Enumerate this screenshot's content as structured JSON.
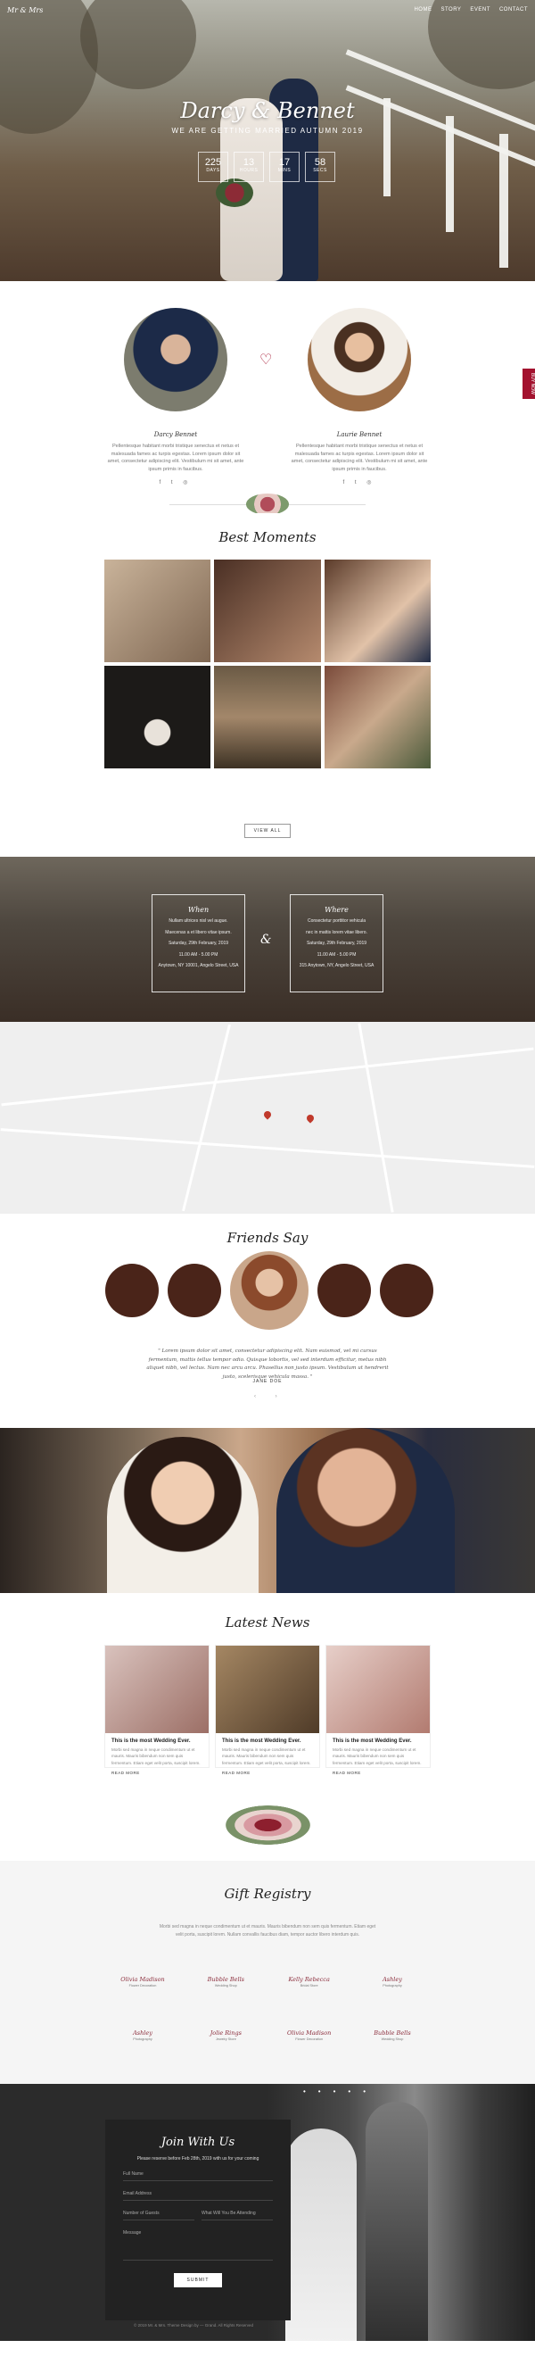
{
  "nav": {
    "logo": "Mr & Mrs",
    "menu": [
      "HOME",
      "STORY",
      "EVENT",
      "CONTACT"
    ]
  },
  "hero": {
    "title": "Darcy & Bennet",
    "subtitle": "WE ARE GETTING MARRIED AUTUMN 2019",
    "countdown": [
      {
        "value": "225",
        "label": "DAYS"
      },
      {
        "value": "13",
        "label": "HOURS"
      },
      {
        "value": "17",
        "label": "MINS"
      },
      {
        "value": "58",
        "label": "SECS"
      }
    ]
  },
  "couple": {
    "groom": {
      "name": "Darcy Bennet",
      "desc": "Pellentesque habitant morbi tristique senectus et netus et malesuada fames ac turpis egestas. Lorem ipsum dolor sit amet, consectetur adipiscing elit. Vestibulum mi sit amet, ante ipsum primis in faucibus.",
      "social": "f  t  ◎"
    },
    "bride": {
      "name": "Laurie Bennet",
      "desc": "Pellentesque habitant morbi tristique senectus et netus et malesuada fames ac turpis egestas. Lorem ipsum dolor sit amet, consectetur adipiscing elit. Vestibulum mi sit amet, ante ipsum primis in faucibus.",
      "social": "f  t  ◎"
    },
    "side_tab": "BUY NOW"
  },
  "moments": {
    "title": "Best Moments",
    "button": "VIEW ALL",
    "photos": [
      "#b79f86",
      "#5b3b2e",
      "#6f4a36",
      "#2a2623",
      "#8b6a4b",
      "#6e4a3a"
    ]
  },
  "event": {
    "cards": [
      {
        "title": "When",
        "lines": [
          "Nullam ultrices nisl vel augue.",
          "Maecenas a et libero vitae ipsum.",
          "Saturday, 29th February, 2019",
          "11.00 AM - 5.00 PM",
          "Anytown, NY 10001, Angelo Street, USA"
        ]
      },
      {
        "title": "Where",
        "lines": [
          "Consectetur porttitor vehicula",
          "nec in mattis lorem vitae libero.",
          "Saturday, 29th February, 2019",
          "11.00 AM - 5.00 PM",
          "315 Anytown, NY, Angelo Street, USA"
        ]
      }
    ],
    "amp": "&"
  },
  "friends": {
    "title": "Friends Say",
    "quote": "\" Lorem ipsum dolor sit amet, consectetur adipiscing elit. Nam euismod, vel mi cursus fermentum, mattis tellus tempor odio. Quisque lobortis, vel sed interdum efficitur, metus nibh aliquet nibh, vel lectus. Nam nec arcu arcu. Phasellus non justo ipsum. Vestibulum ut hendrerit justo, scelerisque vehicula massa. \"",
    "name": "JANE DOE",
    "arrows": "‹  ›"
  },
  "news": {
    "title": "Latest News",
    "cards": [
      {
        "title": "This is the most Wedding Ever.",
        "text": "Morbi sed magna in neque condimentum ut et mauris. Mauris bibendum non sem quis fermentum. Etiam eget velit porta, suscipit lorem.",
        "more": "READ MORE",
        "color": "#c9a7a3"
      },
      {
        "title": "This is the most Wedding Ever.",
        "text": "Morbi sed magna in neque condimentum ut et mauris. Mauris bibendum non sem quis fermentum. Etiam eget velit porta, suscipit lorem.",
        "more": "READ MORE",
        "color": "#8a6a4d"
      },
      {
        "title": "This is the most Wedding Ever.",
        "text": "Morbi sed magna in neque condimentum ut et mauris. Mauris bibendum non sem quis fermentum. Etiam eget velit porta, suscipit lorem.",
        "more": "READ MORE",
        "color": "#d5b1ab"
      }
    ]
  },
  "registry": {
    "title": "Gift Registry",
    "text": "Morbi sed magna in neque condimentum ut et mauris. Mauris bibendum non sem quis fermentum. Etiam eget velit porta, suscipit lorem. Nullam convallis faucibus diam, tempor auctor libero interdum quis.",
    "logos_row1": [
      {
        "name": "Olivia Madison",
        "tag": "Flower Decoration"
      },
      {
        "name": "Bubble Bells",
        "tag": "Wedding Shop"
      },
      {
        "name": "Kelly Rebecca",
        "tag": "Bridal Store"
      },
      {
        "name": "Ashley",
        "tag": "Photography"
      }
    ],
    "logos_row2": [
      {
        "name": "Ashley",
        "tag": "Photography"
      },
      {
        "name": "Jolie Rings",
        "tag": "Jewelry Store"
      },
      {
        "name": "Olivia Madison",
        "tag": "Flower Decoration"
      },
      {
        "name": "Bubble Bells",
        "tag": "Wedding Shop"
      }
    ]
  },
  "join": {
    "title": "Join With Us",
    "lead": "Please reserve before Feb 28th, 2019 with us for your coming",
    "fields": {
      "full_name": "Full Name",
      "email": "Email Address",
      "guests": "Number of Guests",
      "attending": "What Will You Be Attending",
      "message": "Message"
    },
    "submit": "SUBMIT",
    "copyright": "© 2019 Mr. & Mrs. Theme Design by — Grand. All Rights Reserved"
  }
}
